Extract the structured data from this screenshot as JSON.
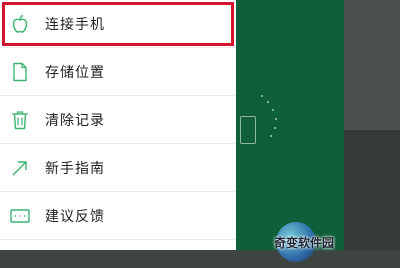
{
  "menu": {
    "items": [
      {
        "label": "连接手机",
        "icon": "apple-icon"
      },
      {
        "label": "存储位置",
        "icon": "document-icon"
      },
      {
        "label": "清除记录",
        "icon": "trash-icon"
      },
      {
        "label": "新手指南",
        "icon": "arrow-up-right-icon"
      },
      {
        "label": "建议反馈",
        "icon": "keyboard-icon"
      }
    ],
    "accent_color": "#3cb371",
    "highlight_color": "#d3142a"
  },
  "watermark": {
    "text": "奇变软件园"
  }
}
